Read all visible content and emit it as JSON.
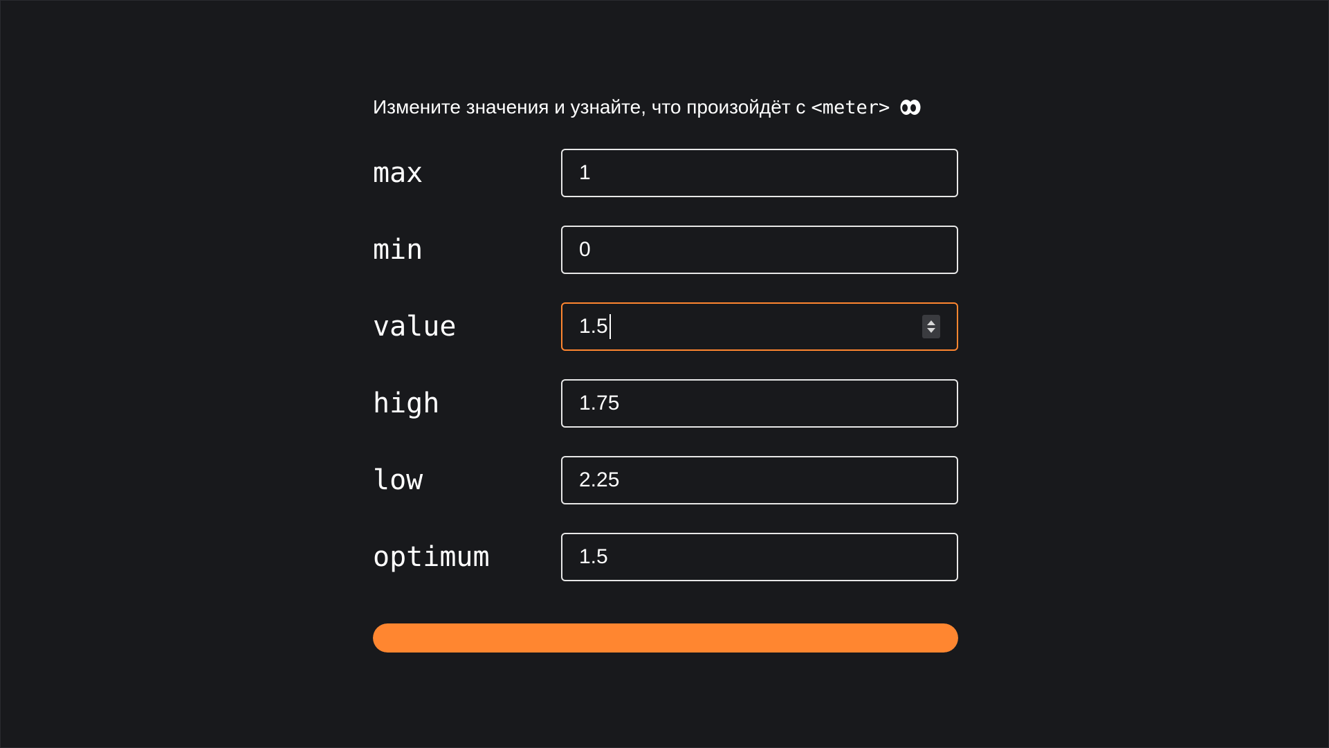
{
  "heading": {
    "text": "Измените значения и узнайте, что произойдёт с",
    "code": "<meter>",
    "icon": "eyes-icon"
  },
  "fields": {
    "max": {
      "label": "max",
      "value": "1"
    },
    "min": {
      "label": "min",
      "value": "0"
    },
    "value": {
      "label": "value",
      "value": "1.5"
    },
    "high": {
      "label": "high",
      "value": "1.75"
    },
    "low": {
      "label": "low",
      "value": "2.25"
    },
    "optimum": {
      "label": "optimum",
      "value": "1.5"
    }
  },
  "meter": {
    "fill_fraction": 1.0,
    "color": "#ff8630"
  },
  "colors": {
    "background": "#18191c",
    "accent": "#ff8630",
    "text": "#ffffff"
  }
}
